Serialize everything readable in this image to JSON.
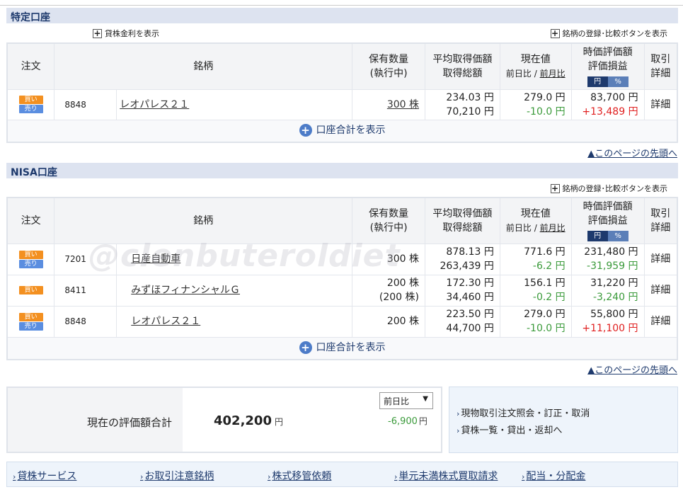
{
  "tokutei": {
    "title": "特定口座",
    "lend_link": "貸株金利を表示",
    "register_link": "銘柄の登録･比較ボタンを表示",
    "rows": [
      {
        "code": "8848",
        "name": "レオパレス２１",
        "qty": "300 株",
        "qty_pending": "",
        "avg": "234.03 円",
        "total_cost": "70,210 円",
        "price": "279.0 円",
        "change": "-10.0 円",
        "value": "83,700 円",
        "pnl": "+13,489 円",
        "detail": "詳細",
        "sell": true
      }
    ],
    "summary_link": "口座合計を表示",
    "top_link": "▲このページの先頭へ"
  },
  "nisa": {
    "title": "NISA口座",
    "register_link": "銘柄の登録･比較ボタンを表示",
    "rows": [
      {
        "code": "7201",
        "name": "日産自動車",
        "qty": "300 株",
        "qty_pending": "",
        "avg": "878.13 円",
        "total_cost": "263,439 円",
        "price": "771.6 円",
        "change": "-6.2 円",
        "value": "231,480 円",
        "pnl": "-31,959 円",
        "detail": "詳細",
        "sell": true
      },
      {
        "code": "8411",
        "name": "みずほフィナンシャルＧ",
        "qty": "200 株",
        "qty_pending": "(200 株)",
        "avg": "172.30 円",
        "total_cost": "34,460 円",
        "price": "156.1 円",
        "change": "-0.2 円",
        "value": "31,220 円",
        "pnl": "-3,240 円",
        "detail": "詳細",
        "sell": false
      },
      {
        "code": "8848",
        "name": "レオパレス２１",
        "qty": "200 株",
        "qty_pending": "",
        "avg": "223.50 円",
        "total_cost": "44,700 円",
        "price": "279.0 円",
        "change": "-10.0 円",
        "value": "55,800 円",
        "pnl": "+11,100 円",
        "detail": "詳細",
        "sell": true
      }
    ],
    "summary_link": "口座合計を表示",
    "top_link": "▲このページの先頭へ"
  },
  "headers": {
    "order": "注文",
    "name": "銘柄",
    "qty1": "保有数量",
    "qty2": "(執行中)",
    "avg1": "平均取得価額",
    "avg2": "取得総額",
    "price1": "現在値",
    "price_prev_day": "前日比",
    "price_sep": "/",
    "price_prev_month": "前月比",
    "value1": "時価評価額",
    "value2": "評価損益",
    "btn_yen": "円",
    "btn_pct": "%",
    "detail1": "取引",
    "detail2": "詳細"
  },
  "order_labels": {
    "buy": "買い",
    "sell": "売り"
  },
  "total": {
    "label": "現在の評価額合計",
    "value": "402,200",
    "unit": "円",
    "select": "前日比",
    "diff": "-6,900",
    "diff_unit": "円"
  },
  "side_links": [
    "現物取引注文照会・訂正・取消",
    "貸株一覧・貸出・返却へ"
  ],
  "footer_links": [
    "貸株サービス",
    "お取引注意銘柄",
    "株式移管依頼",
    "単元未満株式買取請求",
    "配当・分配金"
  ],
  "watermark": "@clenbuteroldiet",
  "colors": {
    "header_bg": "#dde3f0",
    "accent": "#1e3a6d",
    "positive": "#e02020",
    "negative": "#3a9a3a",
    "buy": "#f39020",
    "sell": "#5b8ee0"
  }
}
